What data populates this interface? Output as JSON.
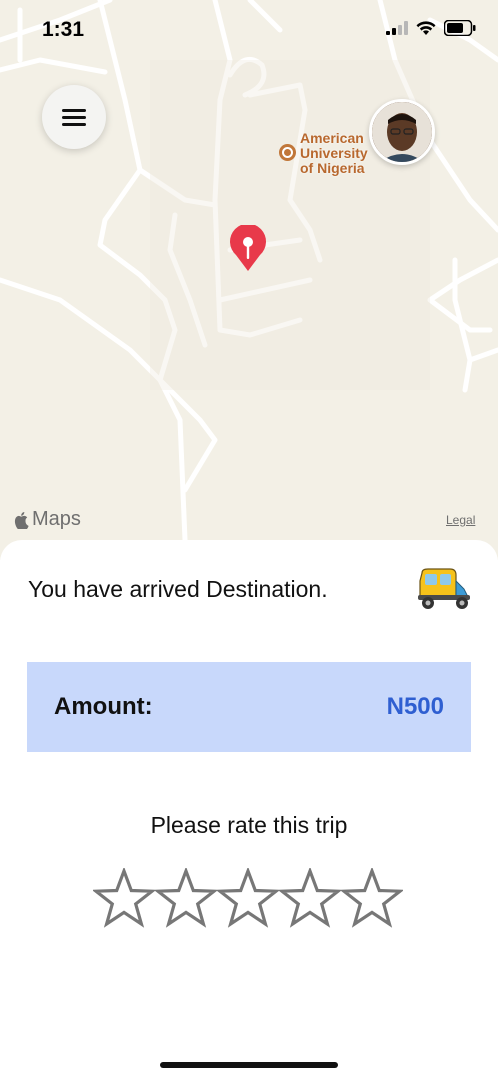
{
  "status_bar": {
    "time": "1:31",
    "icons": [
      "cellular-signal-icon",
      "wifi-icon",
      "battery-icon"
    ]
  },
  "map": {
    "poi": {
      "name_lines": [
        "American",
        "University",
        "of Nigeria"
      ],
      "icon": "university-icon"
    },
    "attribution": "Maps",
    "legal": "Legal",
    "colors": {
      "land": "#f3f0e6",
      "road": "#ffffff",
      "poi_label": "#b8682e",
      "pin": "#e8394a"
    }
  },
  "header": {
    "menu_icon": "hamburger-menu-icon",
    "avatar": "driver-avatar"
  },
  "trip": {
    "message": "You have arrived Destination.",
    "vehicle_icon": "tuktuk-icon",
    "amount_label": "Amount:",
    "amount_value": "N500",
    "amount_bg_color": "#c8d8fb",
    "amount_value_color": "#2f5fd1"
  },
  "rating": {
    "prompt": "Please rate this trip",
    "max_stars": 5,
    "selected": 0
  }
}
